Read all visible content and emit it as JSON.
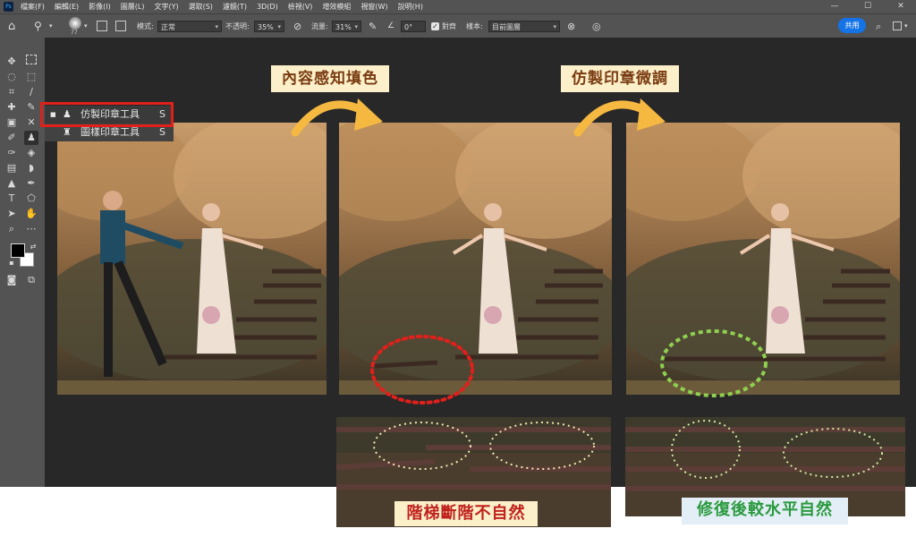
{
  "menubar": {
    "app_icon": "Ps",
    "items": [
      "檔案(F)",
      "編輯(E)",
      "影像(I)",
      "圖層(L)",
      "文字(Y)",
      "選取(S)",
      "濾鏡(T)",
      "3D(D)",
      "檢視(V)",
      "增效模組",
      "視窗(W)",
      "說明(H)"
    ],
    "minimize": "—",
    "maximize": "☐",
    "close": "✕"
  },
  "options": {
    "brush_size": "77",
    "mode_label": "模式:",
    "mode_value": "正常",
    "opacity_label": "不透明:",
    "opacity_value": "35%",
    "flow_label": "流量:",
    "flow_value": "31%",
    "angle_value": "0°",
    "aligned_label": "對齊",
    "sample_label": "樣本:",
    "sample_value": "目前圖層",
    "share_label": "共用"
  },
  "flyout": {
    "items": [
      {
        "label": "仿製印章工具",
        "shortcut": "S"
      },
      {
        "label": "圖樣印章工具",
        "shortcut": "S"
      }
    ]
  },
  "labels": {
    "content_aware": "內容感知填色",
    "clone_refine": "仿製印章微調"
  },
  "captions": {
    "bad": "階梯斷階不自然",
    "good": "修復後較水平自然"
  },
  "colors": {
    "highlight_red": "#e0201b",
    "ellipse_green": "#8fd14f",
    "arrow_yellow": "#f5b942",
    "share_blue": "#1473e6"
  }
}
